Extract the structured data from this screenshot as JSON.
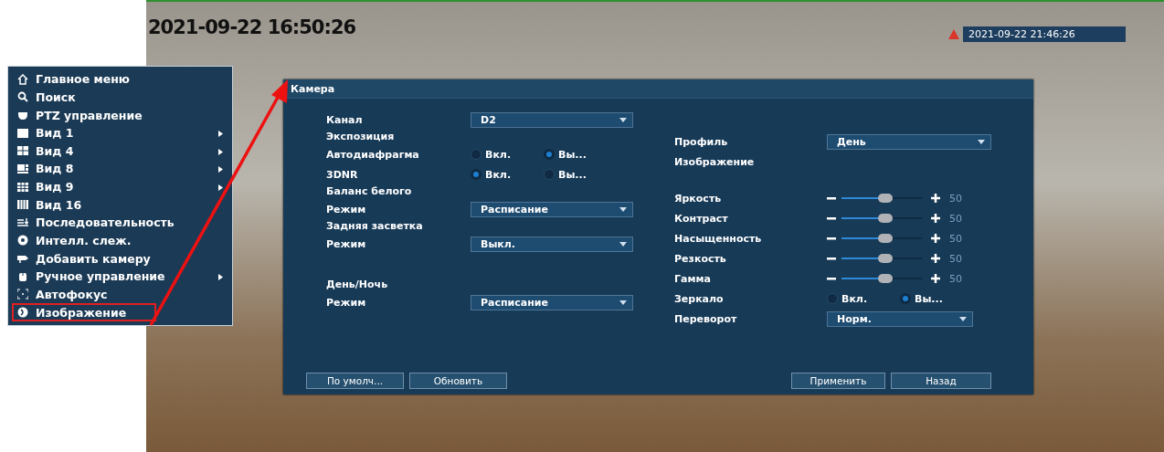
{
  "video": {
    "timestamp": "2021-09-22 16:50:26",
    "clock": "2021-09-22 21:46:26"
  },
  "menu": {
    "items": [
      {
        "label": "Главное меню",
        "submenu": false,
        "highlighted": false
      },
      {
        "label": "Поиск",
        "submenu": false,
        "highlighted": false
      },
      {
        "label": "PTZ управление",
        "submenu": false,
        "highlighted": false
      },
      {
        "label": "Вид 1",
        "submenu": true,
        "highlighted": false
      },
      {
        "label": "Вид 4",
        "submenu": true,
        "highlighted": false
      },
      {
        "label": "Вид 8",
        "submenu": true,
        "highlighted": false
      },
      {
        "label": "Вид 9",
        "submenu": true,
        "highlighted": false
      },
      {
        "label": "Вид 16",
        "submenu": false,
        "highlighted": false
      },
      {
        "label": "Последовательность",
        "submenu": false,
        "highlighted": false
      },
      {
        "label": "Интелл. слеж.",
        "submenu": false,
        "highlighted": false
      },
      {
        "label": "Добавить камеру",
        "submenu": false,
        "highlighted": false
      },
      {
        "label": "Ручное управление",
        "submenu": true,
        "highlighted": false
      },
      {
        "label": "Автофокус",
        "submenu": false,
        "highlighted": false
      },
      {
        "label": "Изображение",
        "submenu": false,
        "highlighted": true
      }
    ]
  },
  "dialog": {
    "title": "Камера",
    "left_sections": [
      {
        "rows": [
          {
            "kind": "select",
            "label": "Канал",
            "value": "D2"
          }
        ]
      },
      {
        "title": "Экспозиция",
        "rows": [
          {
            "kind": "radio",
            "label": "Автодиафрагма",
            "options": [
              {
                "label": "Вкл.",
                "selected": false
              },
              {
                "label": "Вы...",
                "selected": true
              }
            ]
          },
          {
            "kind": "radio",
            "label": "3DNR",
            "options": [
              {
                "label": "Вкл.",
                "selected": true
              },
              {
                "label": "Вы...",
                "selected": false
              }
            ]
          }
        ]
      },
      {
        "title": "Баланс белого",
        "rows": [
          {
            "kind": "select",
            "label": "Режим",
            "value": "Расписание"
          }
        ]
      },
      {
        "title": "Задняя засветка",
        "rows": [
          {
            "kind": "select",
            "label": "Режим",
            "value": "Выкл."
          }
        ]
      },
      {
        "title": "День/Ночь",
        "rows": [
          {
            "kind": "select",
            "label": "Режим",
            "value": "Расписание"
          }
        ]
      }
    ],
    "right_sections": [
      {
        "rows": [
          {
            "kind": "select",
            "label": "Профиль",
            "value": "День"
          }
        ]
      },
      {
        "title": "Изображение",
        "rows": [
          {
            "kind": "slider",
            "label": "Яркость",
            "level": 0.55,
            "reading": "50"
          },
          {
            "kind": "slider",
            "label": "Контраст",
            "level": 0.55,
            "reading": "50"
          },
          {
            "kind": "slider",
            "label": "Насыщенность",
            "level": 0.55,
            "reading": "50"
          },
          {
            "kind": "slider",
            "label": "Резкость",
            "level": 0.55,
            "reading": "50"
          },
          {
            "kind": "slider",
            "label": "Гамма",
            "level": 0.55,
            "reading": "50"
          },
          {
            "kind": "radio",
            "label": "Зеркало",
            "options": [
              {
                "label": "Вкл.",
                "selected": false
              },
              {
                "label": "Вы...",
                "selected": true
              }
            ]
          },
          {
            "kind": "select",
            "label": "Переворот",
            "value": "Норм."
          }
        ]
      }
    ],
    "buttons_left": [
      "По умолч...",
      "Обновить"
    ],
    "buttons_right": [
      "Применить",
      "Назад"
    ]
  }
}
